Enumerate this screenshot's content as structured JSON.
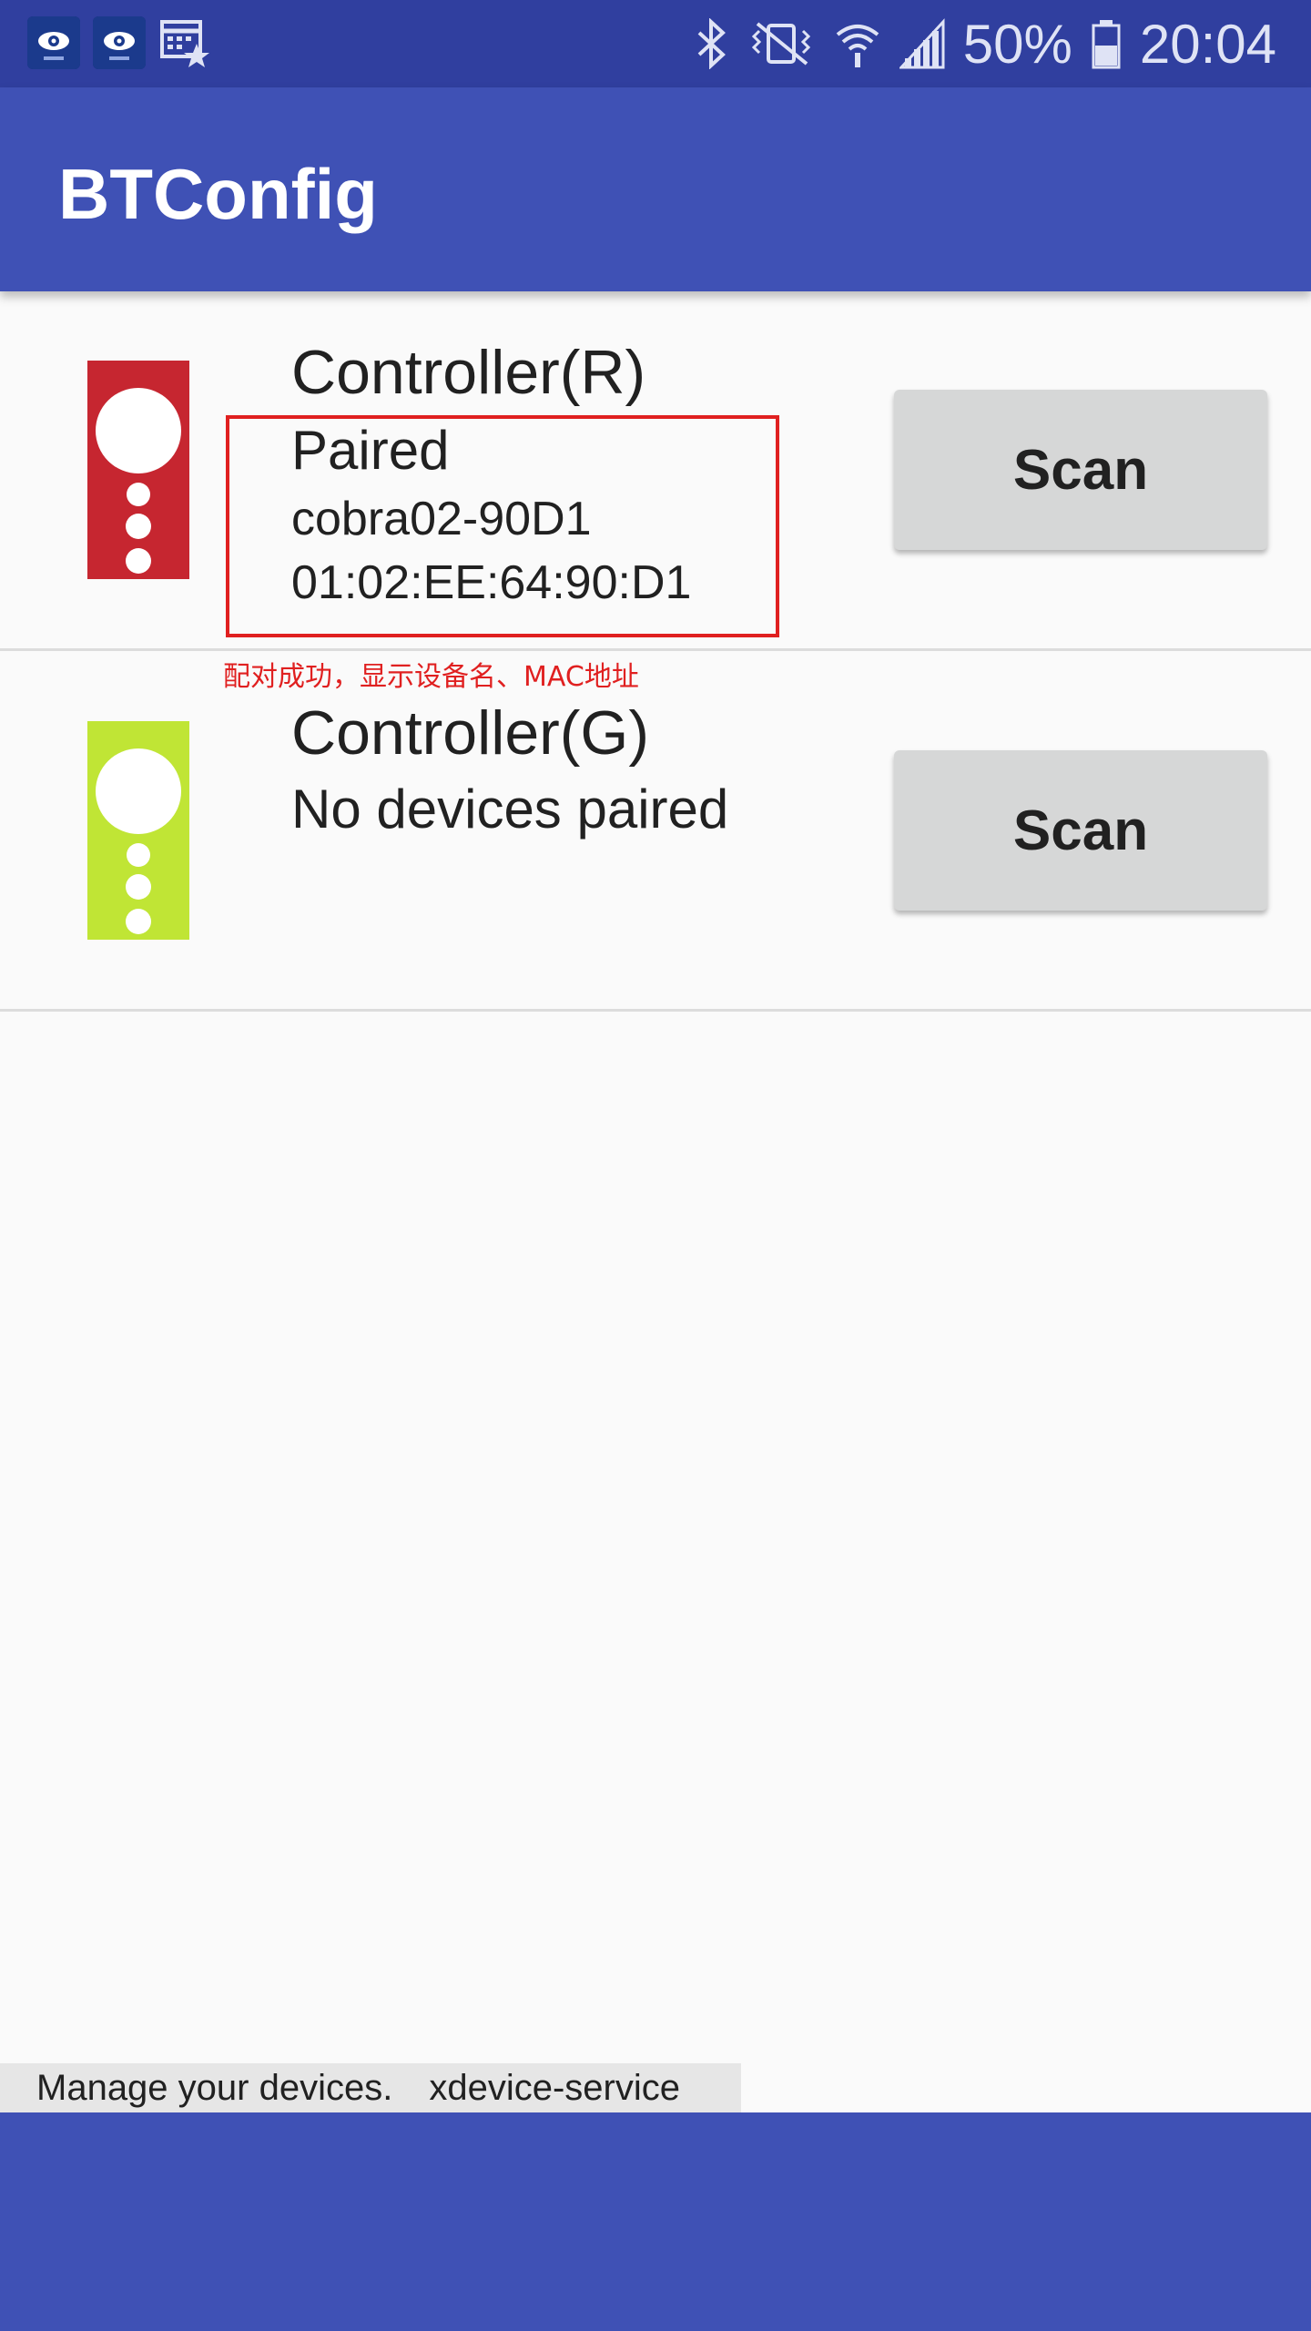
{
  "status_bar": {
    "battery": "50%",
    "time": "20:04",
    "icons": [
      "gear-vr-icon",
      "gear-vr-icon",
      "calendar-star-icon",
      "bluetooth-icon",
      "vibrate-mute-icon",
      "wifi-icon",
      "signal-icon",
      "battery-icon"
    ]
  },
  "app_bar": {
    "title": "BTConfig"
  },
  "devices": [
    {
      "name": "Controller(R)",
      "status": "Paired",
      "device_name": "cobra02-90D1",
      "mac": "01:02:EE:64:90:D1",
      "scan_label": "Scan",
      "color": "#c62630"
    },
    {
      "name": "Controller(G)",
      "status": "No devices paired",
      "scan_label": "Scan",
      "color": "#c0e535"
    }
  ],
  "annotation": {
    "text": "配对成功，显示设备名、MAC地址",
    "color": "#e02020"
  },
  "footer": {
    "manage_text": "Manage your devices.",
    "service_text": "xdevice-service 1"
  },
  "colors": {
    "primary": "#3f51b5",
    "primary_dark": "#303f9f"
  }
}
